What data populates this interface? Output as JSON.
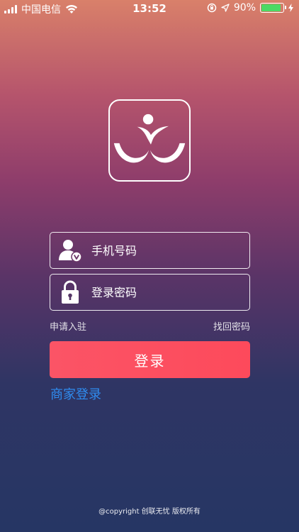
{
  "status_bar": {
    "carrier": "中国电信",
    "time": "13:52",
    "battery_percent": "90%",
    "battery_level": 0.9,
    "battery_color": "#4cd964"
  },
  "login_form": {
    "phone_placeholder": "手机号码",
    "password_placeholder": "登录密码",
    "apply_link": "申请入驻",
    "forgot_link": "找回密码",
    "login_button": "登录",
    "merchant_login": "商家登录"
  },
  "footer": {
    "copyright": "@copyright 创联无忧 版权所有"
  },
  "colors": {
    "login_button": "#fd4a5b",
    "merchant_link": "#2f8cf0"
  },
  "icons": [
    "signal-icon",
    "wifi-icon",
    "rotation-lock-icon",
    "location-arrow-icon",
    "battery-icon",
    "charging-bolt-icon",
    "app-logo",
    "user-icon",
    "lock-icon"
  ]
}
